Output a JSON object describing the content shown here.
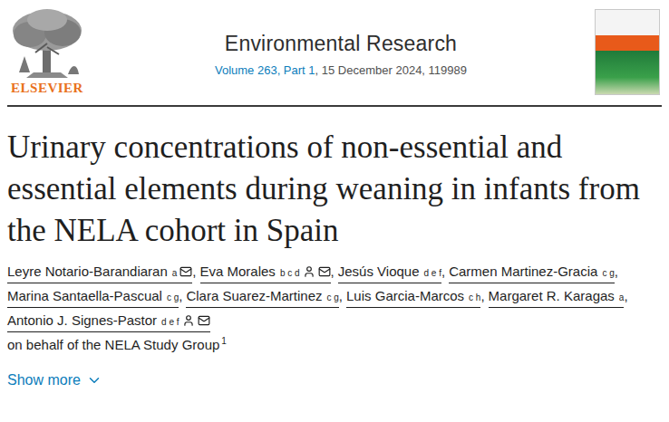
{
  "publisher": {
    "logo_text": "ELSEVIER"
  },
  "journal": {
    "name": "Environmental Research",
    "volume_link": "Volume 263, Part 1",
    "issue_rest": ", 15 December 2024, 119989"
  },
  "title": "Urinary concentrations of non-essential and essential elements during weaning in infants from the NELA cohort in Spain",
  "authors": [
    {
      "name": "Leyre Notario-Barandiaran",
      "affiliations": "a",
      "corresponding": false,
      "email": true,
      "separator": ","
    },
    {
      "name": "Eva Morales",
      "affiliations": "b c d",
      "corresponding": true,
      "email": true,
      "separator": ","
    },
    {
      "name": "Jesús Vioque",
      "affiliations": "d e f",
      "corresponding": false,
      "email": false,
      "separator": ","
    },
    {
      "name": "Carmen Martinez-Gracia",
      "affiliations": "c g",
      "corresponding": false,
      "email": false,
      "separator": ","
    },
    {
      "name": "Marina Santaella-Pascual",
      "affiliations": "c g",
      "corresponding": false,
      "email": false,
      "separator": ","
    },
    {
      "name": "Clara Suarez-Martinez",
      "affiliations": "c g",
      "corresponding": false,
      "email": false,
      "separator": ","
    },
    {
      "name": "Luis Garcia-Marcos",
      "affiliations": "c h",
      "corresponding": false,
      "email": false,
      "separator": ","
    },
    {
      "name": "Margaret R. Karagas",
      "affiliations": "a",
      "corresponding": false,
      "email": false,
      "separator": ","
    },
    {
      "name": "Antonio J. Signes-Pastor",
      "affiliations": "d e f",
      "corresponding": true,
      "email": true,
      "separator": ""
    }
  ],
  "group": {
    "text": "on behalf of the NELA Study Group",
    "note": "1"
  },
  "show_more": {
    "label": "Show more",
    "expanded": false
  }
}
